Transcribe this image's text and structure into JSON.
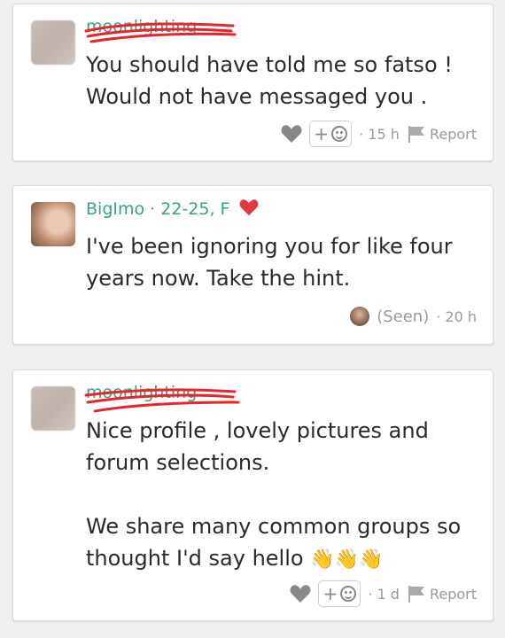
{
  "messages": [
    {
      "sender": "moonlighting",
      "text": "You should have told me so fatso !\nWould not have messaged you .",
      "time": "· 15 h",
      "react_plus": "+",
      "report": "Report"
    },
    {
      "sender": "BigImo",
      "meta": "· 22-25, F",
      "text": "I've been ignoring you for like four\nyears now. Take the hint.",
      "seen": "(Seen)",
      "time": "· 20 h"
    },
    {
      "sender": "moonlighting",
      "text": "Nice profile , lovely pictures and\nforum selections.\n\nWe share many common groups so\nthought I'd say hello",
      "emoji": "👋👋👋",
      "time": "· 1 d",
      "react_plus": "+",
      "report": "Report"
    }
  ],
  "colors": {
    "accent": "#3aa089",
    "heart": "#e0393e",
    "scribble": "#e8252a",
    "meta": "#9a9a9a"
  },
  "icons": {
    "like": "heart-icon",
    "react": "smiley-icon",
    "report": "flag-icon",
    "favorite": "heart-icon"
  }
}
